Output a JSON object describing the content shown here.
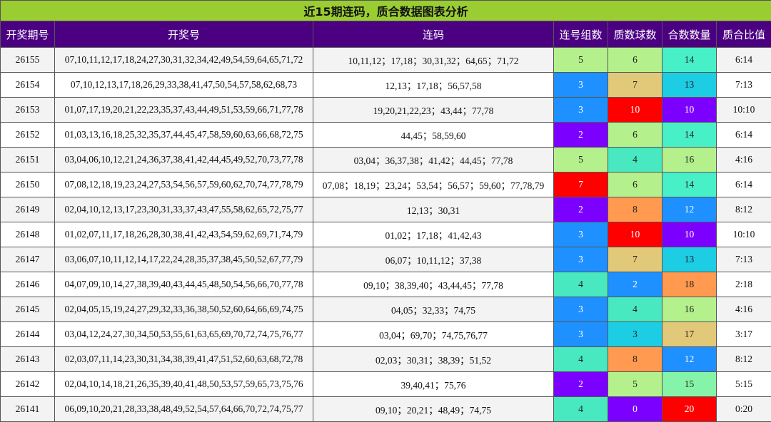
{
  "title": "近15期连码，质合数据图表分析",
  "headers": [
    "开奖期号",
    "开奖号",
    "连码",
    "连号组数",
    "质数球数",
    "合数数量",
    "质合比值"
  ],
  "palette": {
    "0": "#7b00ff",
    "2": "#1e90ff",
    "3": "#1e90ff",
    "4": "#48e8c0",
    "5": "#b4f08c",
    "6": "#b4f08c",
    "7": "#e2c97a",
    "8": "#ff9a50",
    "10": "#7b00ff",
    "12": "#1e90ff",
    "13": "#1ccde4",
    "14": "#48f0c8",
    "15": "#86f4a8",
    "16": "#b4f08c",
    "17": "#e2c97a",
    "18": "#ff9a50",
    "20": "#ff0000"
  },
  "rows": [
    {
      "issue": "26155",
      "numbers": "07,10,11,12,17,18,24,27,30,31,32,34,42,49,54,59,64,65,71,72",
      "consec": "10,11,12；17,18；30,31,32；64,65；71,72",
      "groups": "5",
      "groups_color": "#b4f08c",
      "primes": "6",
      "primes_color": "#b4f08c",
      "composites": "14",
      "composites_color": "#48f0c8",
      "ratio": "6:14"
    },
    {
      "issue": "26154",
      "numbers": "07,10,12,13,17,18,26,29,33,38,41,47,50,54,57,58,62,68,73",
      "consec": "12,13；17,18；56,57,58",
      "groups": "3",
      "groups_color": "#1e90ff",
      "primes": "7",
      "primes_color": "#e2c97a",
      "composites": "13",
      "composites_color": "#1ccde4",
      "ratio": "7:13"
    },
    {
      "issue": "26153",
      "numbers": "01,07,17,19,20,21,22,23,35,37,43,44,49,51,53,59,66,71,77,78",
      "consec": "19,20,21,22,23；43,44；77,78",
      "groups": "3",
      "groups_color": "#1e90ff",
      "primes": "10",
      "primes_color": "#ff0000",
      "composites": "10",
      "composites_color": "#7b00ff",
      "ratio": "10:10"
    },
    {
      "issue": "26152",
      "numbers": "01,03,13,16,18,25,32,35,37,44,45,47,58,59,60,63,66,68,72,75",
      "consec": "44,45；58,59,60",
      "groups": "2",
      "groups_color": "#7b00ff",
      "primes": "6",
      "primes_color": "#b4f08c",
      "composites": "14",
      "composites_color": "#48f0c8",
      "ratio": "6:14"
    },
    {
      "issue": "26151",
      "numbers": "03,04,06,10,12,21,24,36,37,38,41,42,44,45,49,52,70,73,77,78",
      "consec": "03,04；36,37,38；41,42；44,45；77,78",
      "groups": "5",
      "groups_color": "#b4f08c",
      "primes": "4",
      "primes_color": "#48e8c0",
      "composites": "16",
      "composites_color": "#b4f08c",
      "ratio": "4:16"
    },
    {
      "issue": "26150",
      "numbers": "07,08,12,18,19,23,24,27,53,54,56,57,59,60,62,70,74,77,78,79",
      "consec": "07,08；18,19；23,24；53,54；56,57；59,60；77,78,79",
      "groups": "7",
      "groups_color": "#ff0000",
      "primes": "6",
      "primes_color": "#b4f08c",
      "composites": "14",
      "composites_color": "#48f0c8",
      "ratio": "6:14"
    },
    {
      "issue": "26149",
      "numbers": "02,04,10,12,13,17,23,30,31,33,37,43,47,55,58,62,65,72,75,77",
      "consec": "12,13；30,31",
      "groups": "2",
      "groups_color": "#7b00ff",
      "primes": "8",
      "primes_color": "#ff9a50",
      "composites": "12",
      "composites_color": "#1e90ff",
      "ratio": "8:12"
    },
    {
      "issue": "26148",
      "numbers": "01,02,07,11,17,18,26,28,30,38,41,42,43,54,59,62,69,71,74,79",
      "consec": "01,02；17,18；41,42,43",
      "groups": "3",
      "groups_color": "#1e90ff",
      "primes": "10",
      "primes_color": "#ff0000",
      "composites": "10",
      "composites_color": "#7b00ff",
      "ratio": "10:10"
    },
    {
      "issue": "26147",
      "numbers": "03,06,07,10,11,12,14,17,22,24,28,35,37,38,45,50,52,67,77,79",
      "consec": "06,07；10,11,12；37,38",
      "groups": "3",
      "groups_color": "#1e90ff",
      "primes": "7",
      "primes_color": "#e2c97a",
      "composites": "13",
      "composites_color": "#1ccde4",
      "ratio": "7:13"
    },
    {
      "issue": "26146",
      "numbers": "04,07,09,10,14,27,38,39,40,43,44,45,48,50,54,56,66,70,77,78",
      "consec": "09,10；38,39,40；43,44,45；77,78",
      "groups": "4",
      "groups_color": "#48e8c0",
      "primes": "2",
      "primes_color": "#1e90ff",
      "composites": "18",
      "composites_color": "#ff9a50",
      "ratio": "2:18"
    },
    {
      "issue": "26145",
      "numbers": "02,04,05,15,19,24,27,29,32,33,36,38,50,52,60,64,66,69,74,75",
      "consec": "04,05；32,33；74,75",
      "groups": "3",
      "groups_color": "#1e90ff",
      "primes": "4",
      "primes_color": "#48e8c0",
      "composites": "16",
      "composites_color": "#b4f08c",
      "ratio": "4:16"
    },
    {
      "issue": "26144",
      "numbers": "03,04,12,24,27,30,34,50,53,55,61,63,65,69,70,72,74,75,76,77",
      "consec": "03,04；69,70；74,75,76,77",
      "groups": "3",
      "groups_color": "#1e90ff",
      "primes": "3",
      "primes_color": "#1ccde4",
      "composites": "17",
      "composites_color": "#e2c97a",
      "ratio": "3:17"
    },
    {
      "issue": "26143",
      "numbers": "02,03,07,11,14,23,30,31,34,38,39,41,47,51,52,60,63,68,72,78",
      "consec": "02,03；30,31；38,39；51,52",
      "groups": "4",
      "groups_color": "#48e8c0",
      "primes": "8",
      "primes_color": "#ff9a50",
      "composites": "12",
      "composites_color": "#1e90ff",
      "ratio": "8:12"
    },
    {
      "issue": "26142",
      "numbers": "02,04,10,14,18,21,26,35,39,40,41,48,50,53,57,59,65,73,75,76",
      "consec": "39,40,41；75,76",
      "groups": "2",
      "groups_color": "#7b00ff",
      "primes": "5",
      "primes_color": "#b4f08c",
      "composites": "15",
      "composites_color": "#86f4a8",
      "ratio": "5:15"
    },
    {
      "issue": "26141",
      "numbers": "06,09,10,20,21,28,33,38,48,49,52,54,57,64,66,70,72,74,75,77",
      "consec": "09,10；20,21；48,49；74,75",
      "groups": "4",
      "groups_color": "#48e8c0",
      "primes": "0",
      "primes_color": "#7b00ff",
      "composites": "20",
      "composites_color": "#ff0000",
      "ratio": "0:20"
    }
  ]
}
